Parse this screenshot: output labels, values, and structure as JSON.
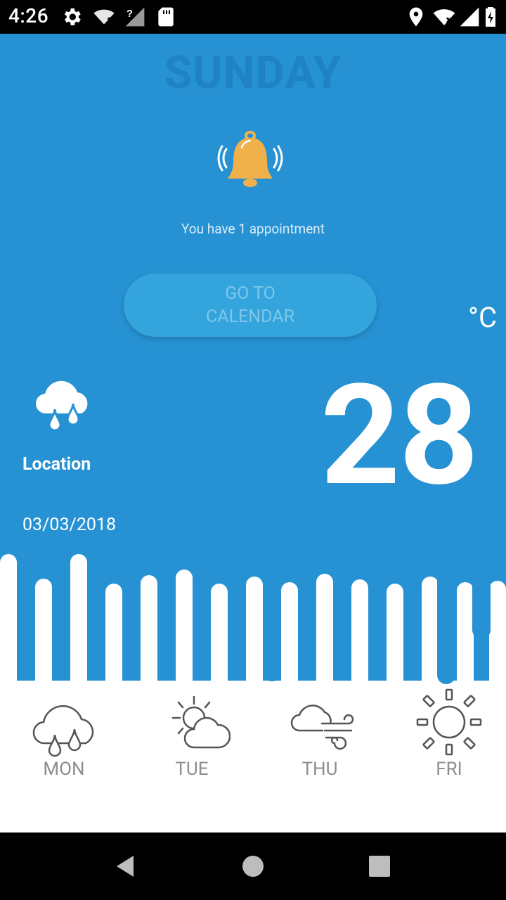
{
  "status_bar": {
    "time": "4:26",
    "icons": [
      "settings-icon",
      "wifi-question-icon",
      "signal-question-icon",
      "sd-card-icon",
      "location-icon",
      "wifi-off-icon",
      "signal-icon",
      "battery-charging-icon"
    ]
  },
  "header": {
    "day": "SUNDAY"
  },
  "notification": {
    "icon": "bell-ringing-icon",
    "text": "You have 1 appointment",
    "button_label": "GO TO CALENDAR"
  },
  "weather": {
    "icon": "rain-cloud-icon",
    "location": "Location",
    "date": "03/03/2018",
    "temperature": "28",
    "unit": "°C"
  },
  "forecast": [
    {
      "day": "MON",
      "icon": "rain-cloud-icon"
    },
    {
      "day": "TUE",
      "icon": "partly-sunny-icon"
    },
    {
      "day": "THU",
      "icon": "cloud-wind-icon"
    },
    {
      "day": "FRI",
      "icon": "sun-icon"
    }
  ],
  "colors": {
    "primary_blue": "#2692d3",
    "bell": "#f0b04a",
    "forecast_text": "#8e8e8e"
  },
  "nav_bar": {
    "buttons": [
      "back-icon",
      "home-icon",
      "recents-icon"
    ]
  }
}
